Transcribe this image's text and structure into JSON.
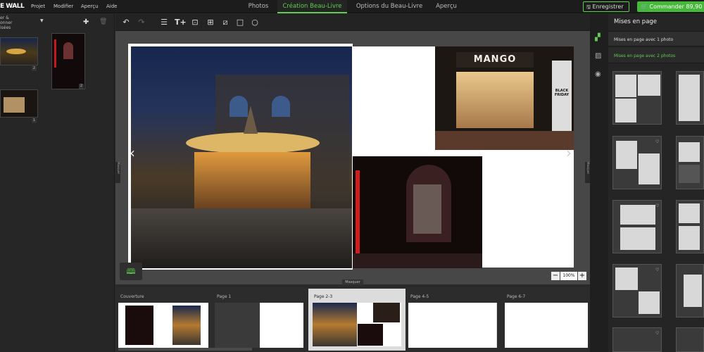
{
  "app": {
    "logo": "E WALL"
  },
  "menu": [
    "Projet",
    "Modifier",
    "Aperçu",
    "Aide"
  ],
  "tabs": [
    {
      "label": "Photos",
      "active": false
    },
    {
      "label": "Création Beau-Livre",
      "active": true
    },
    {
      "label": "Options du Beau-Livre",
      "active": false
    },
    {
      "label": "Aperçu",
      "active": false
    }
  ],
  "actions": {
    "save": "Enregistrer",
    "order": "Commander 89,90"
  },
  "left_panel": {
    "sort_label_1": "er &",
    "sort_label_2": "onner",
    "sort_label_3": "isées",
    "photos": [
      {
        "badge": "2"
      },
      {
        "badge": "2"
      },
      {
        "badge": "1"
      }
    ]
  },
  "side_tabs": {
    "masquer_left": "Masquer",
    "masquer_right": "Masquer",
    "masquer_bottom": "Masquer"
  },
  "canvas": {
    "zoom": "100%",
    "right_photo_text": "MANGO",
    "storefront_sign": "BLACK FRIDAY"
  },
  "right_panel": {
    "title": "Mises en page",
    "option_1": "Mises en page avec 1 photo",
    "option_2": "Mises en page avec 2 photos"
  },
  "filmstrip": [
    {
      "label": "Couverture"
    },
    {
      "label": "Page 1"
    },
    {
      "label": "Page 2-3",
      "active": true
    },
    {
      "label": "Page 4-5"
    },
    {
      "label": "Page 6-7"
    }
  ],
  "colors": {
    "accent": "#5fce4e",
    "order": "#46b83a",
    "bg": "#2a2a2a"
  }
}
